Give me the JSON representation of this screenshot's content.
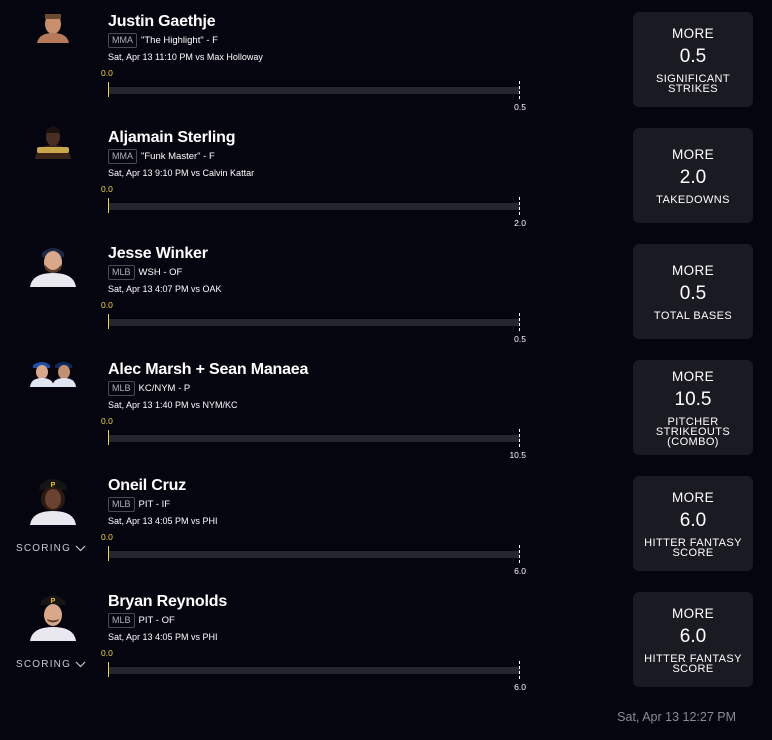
{
  "picks": [
    {
      "name": "Justin Gaethje",
      "league": "MMA",
      "detail": "\"The Highlight\" - F",
      "game": "Sat, Apr 13 11:10 PM  vs Max Holloway",
      "current": "0.0",
      "line": "0.5",
      "progress_fraction": 0,
      "direction": "MORE",
      "card_line": "0.5",
      "stat": "SIGNIFICANT STRIKES",
      "scoring": ""
    },
    {
      "name": "Aljamain Sterling",
      "league": "MMA",
      "detail": "\"Funk Master\" - F",
      "game": "Sat, Apr 13 9:10 PM  vs Calvin Kattar",
      "current": "0.0",
      "line": "2.0",
      "progress_fraction": 0,
      "direction": "MORE",
      "card_line": "2.0",
      "stat": "TAKEDOWNS",
      "scoring": ""
    },
    {
      "name": "Jesse Winker",
      "league": "MLB",
      "detail": "WSH - OF",
      "game": "Sat, Apr 13 4:07 PM  vs OAK",
      "current": "0.0",
      "line": "0.5",
      "progress_fraction": 0,
      "direction": "MORE",
      "card_line": "0.5",
      "stat": "TOTAL BASES",
      "scoring": ""
    },
    {
      "name": "Alec Marsh + Sean Manaea",
      "league": "MLB",
      "detail": "KC/NYM - P",
      "game": "Sat, Apr 13 1:40 PM  vs NYM/KC",
      "current": "0.0",
      "line": "10.5",
      "progress_fraction": 0,
      "direction": "MORE",
      "card_line": "10.5",
      "stat": "PITCHER STRIKEOUTS (COMBO)",
      "scoring": ""
    },
    {
      "name": "Oneil Cruz",
      "league": "MLB",
      "detail": "PIT - IF",
      "game": "Sat, Apr 13 4:05 PM  vs PHI",
      "current": "0.0",
      "line": "6.0",
      "progress_fraction": 0,
      "direction": "MORE",
      "card_line": "6.0",
      "stat": "HITTER FANTASY SCORE",
      "scoring": "SCORING"
    },
    {
      "name": "Bryan Reynolds",
      "league": "MLB",
      "detail": "PIT - OF",
      "game": "Sat, Apr 13 4:05 PM  vs PHI",
      "current": "0.0",
      "line": "6.0",
      "progress_fraction": 0,
      "direction": "MORE",
      "card_line": "6.0",
      "stat": "HITTER FANTASY SCORE",
      "scoring": "SCORING"
    }
  ],
  "footer": {
    "timestamp": "Sat, Apr 13 12:27 PM"
  },
  "colors": {
    "background": "#05050f",
    "card": "#1a1a23",
    "accent_yellow": "#f5d33a",
    "track": "#26262f"
  },
  "icons": {
    "scoring_toggle": "chevron-down-icon",
    "avatar": "player-headshot"
  }
}
